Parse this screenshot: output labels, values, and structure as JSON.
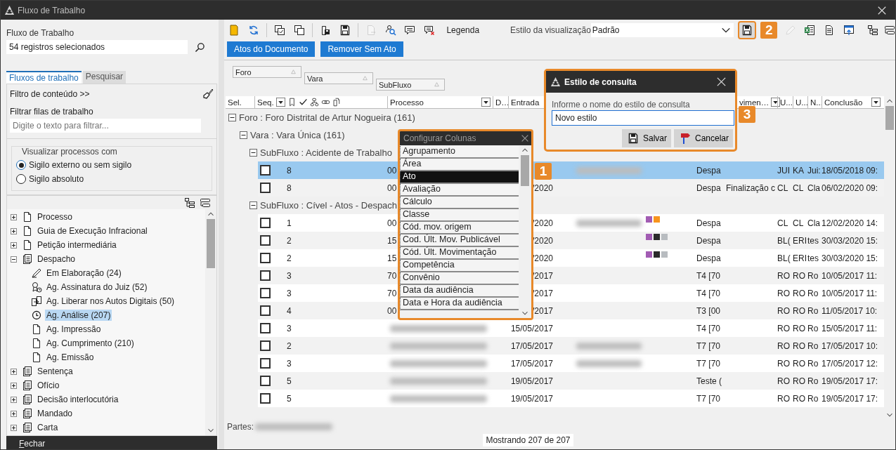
{
  "window": {
    "title": "Fluxo de Trabalho"
  },
  "sidebar": {
    "label": "Fluxo de Trabalho",
    "selection_field": {
      "value": "54 registros selecionados"
    },
    "tabs": [
      {
        "label": "Fluxos de trabalho",
        "selected": true
      },
      {
        "label": "Pesquisar",
        "selected": false
      }
    ],
    "content_filter": "Filtro de conteúdo >>",
    "filter_label": "Filtrar filas de trabalho",
    "filter_field": {
      "placeholder": "Digite o texto para filtrar..."
    },
    "visibility": {
      "legend": "Visualizar processos com",
      "options": [
        {
          "label": "Sigilo externo ou sem sigilo",
          "selected": true
        },
        {
          "label": "Sigilo absoluto",
          "selected": false
        }
      ]
    },
    "tree": [
      {
        "label": "Processo",
        "kind": "page",
        "expanded": false,
        "selected": false
      },
      {
        "label": "Guia de Execução Infracional",
        "kind": "page",
        "expanded": false,
        "selected": false
      },
      {
        "label": "Petição intermediária",
        "kind": "page",
        "expanded": false,
        "selected": false
      },
      {
        "label": "Despacho",
        "kind": "stack",
        "expanded": true,
        "selected": false,
        "children": [
          {
            "label": "Em Elaboração (24)",
            "kind": "pen",
            "selected": false
          },
          {
            "label": "Ag. Assinatura do Juiz (52)",
            "kind": "seal",
            "selected": false
          },
          {
            "label": "Ag. Liberar nos Autos Digitais (50)",
            "kind": "transfer",
            "selected": false
          },
          {
            "label": "Ag. Análise (207)",
            "kind": "clock",
            "selected": true
          },
          {
            "label": "Ag. Impressão",
            "kind": "page",
            "selected": false
          },
          {
            "label": "Ag. Cumprimento (210)",
            "kind": "page",
            "selected": false
          },
          {
            "label": "Ag. Emissão",
            "kind": "page",
            "selected": false
          }
        ]
      },
      {
        "label": "Sentença",
        "kind": "stack",
        "expanded": false,
        "selected": false
      },
      {
        "label": "Ofício",
        "kind": "stack",
        "expanded": false,
        "selected": false
      },
      {
        "label": "Decisão interlocutória",
        "kind": "stack",
        "expanded": false,
        "selected": false
      },
      {
        "label": "Mandado",
        "kind": "stack",
        "expanded": false,
        "selected": false
      },
      {
        "label": "Carta",
        "kind": "stack",
        "expanded": false,
        "selected": false
      }
    ],
    "close_button": "Fechar"
  },
  "main": {
    "toolbar": {
      "tools": [
        {
          "kind": "note",
          "disabled": false
        },
        {
          "kind": "refresh",
          "disabled": false
        },
        {
          "kind": "select",
          "disabled": false
        },
        {
          "kind": "copy",
          "disabled": false
        },
        {
          "kind": "paste",
          "disabled": false
        },
        {
          "kind": "floppy",
          "disabled": false
        },
        {
          "kind": "export",
          "disabled": true
        },
        {
          "kind": "inspect",
          "disabled": false
        },
        {
          "kind": "comment",
          "disabled": false
        },
        {
          "kind": "uncomment",
          "disabled": false
        }
      ],
      "legend": "Legenda",
      "view_style_label": "Estilo da visualização",
      "view_style": {
        "value": "Padrão"
      },
      "style_tools": [
        {
          "kind": "floppy",
          "disabled": false
        },
        {
          "kind": "pencil",
          "disabled": true
        },
        {
          "kind": "excel",
          "disabled": false
        },
        {
          "kind": "document",
          "disabled": false
        },
        {
          "kind": "window",
          "disabled": false
        }
      ]
    },
    "actions": [
      "Atos do Documento",
      "Remover Sem Ato"
    ],
    "grouping": [
      "Foro",
      "Vara",
      "SubFluxo"
    ],
    "table": {
      "columns": [
        "Sel.",
        "Seq.",
        "Processo",
        "D…",
        "Entrada",
        "vimen…",
        "U...",
        "U...",
        "N...",
        "Conclusão"
      ],
      "groups": [
        {
          "label": "Foro : Foro Distrital de Artur Nogueira  (161)",
          "expanded": true,
          "children": [
            {
              "label": "Vara : Vara Única  (161)",
              "expanded": true,
              "children": [
                {
                  "label": "SubFluxo : Acidente de Trabalho",
                  "expanded": true,
                  "rows": [
                    {
                      "seq": "8",
                      "process": "00",
                      "blurred_party": true,
                      "blurred_process": false,
                      "tags": [],
                      "act": "Despa",
                      "u1": "JUI",
                      "u2": "KA",
                      "n": "Jui:",
                      "conclusion": "18/05/2018 09:",
                      "checked": false,
                      "selected": true
                    },
                    {
                      "seq": "8",
                      "process": "00",
                      "entry": "/2020",
                      "blurred_party": false,
                      "blurred_process": false,
                      "tags": [],
                      "act": "Despa",
                      "movement": "Finalização c",
                      "u1": "CL",
                      "u2": "CL",
                      "n": "Cla",
                      "conclusion": "06/02/2020 09:",
                      "checked": false,
                      "selected": false
                    }
                  ]
                },
                {
                  "label": "SubFluxo : Cível - Atos - Despach",
                  "expanded": true,
                  "rows": [
                    {
                      "seq": "1",
                      "process": "00",
                      "entry": "/2020",
                      "blurred_party": true,
                      "blurred_process": false,
                      "tags": [
                        {
                          "color": "#a25cb3"
                        },
                        {
                          "color": "#f7941d"
                        }
                      ],
                      "act": "Despa",
                      "u1": "CL",
                      "u2": "CL",
                      "n": "Cla",
                      "conclusion": "12/02/2020 14:",
                      "checked": false,
                      "selected": false
                    },
                    {
                      "seq": "2",
                      "process": "15",
                      "entry": "/2020",
                      "blurred_party": false,
                      "blurred_process": false,
                      "tags": [
                        {
                          "color": "#a25cb3"
                        },
                        {
                          "color": "#2b2b2b"
                        },
                        {
                          "color": "#b8bcc0"
                        }
                      ],
                      "act": "Despa",
                      "u1": "BL(",
                      "u2": "ERI",
                      "n": "tes",
                      "conclusion": "30/03/2020 15:",
                      "checked": false,
                      "selected": false
                    },
                    {
                      "seq": "2",
                      "process": "15",
                      "entry": "/2020",
                      "blurred_party": false,
                      "blurred_process": false,
                      "tags": [
                        {
                          "color": "#a25cb3"
                        },
                        {
                          "color": "#2b2b2b"
                        },
                        {
                          "color": "#b8bcc0"
                        }
                      ],
                      "act": "Despa",
                      "u1": "BL(",
                      "u2": "ERI",
                      "n": "tes",
                      "conclusion": "30/03/2020 15:",
                      "checked": false,
                      "selected": false
                    },
                    {
                      "seq": "3",
                      "process": "70",
                      "entry": "/2017",
                      "blurred_party": false,
                      "blurred_process": false,
                      "tags": [],
                      "act": "T4 [70",
                      "u1": "RO",
                      "u2": "RO",
                      "n": "Ro",
                      "conclusion": "10/05/2017 11:",
                      "checked": false,
                      "selected": false
                    },
                    {
                      "seq": "3",
                      "process": "70",
                      "entry": "/2017",
                      "blurred_party": false,
                      "blurred_process": false,
                      "tags": [],
                      "act": "T4 [70",
                      "u1": "RO",
                      "u2": "RO",
                      "n": "Ro",
                      "conclusion": "10/05/2017 11:",
                      "checked": false,
                      "selected": false
                    },
                    {
                      "seq": "4",
                      "process": "00",
                      "entry": "/2017",
                      "blurred_party": false,
                      "blurred_process": false,
                      "tags": [],
                      "act": "T3 [00",
                      "u1": "RO",
                      "u2": "RO",
                      "n": "Ro",
                      "conclusion": "11/05/2017 10:",
                      "checked": false,
                      "selected": false
                    },
                    {
                      "seq": "3",
                      "entry": "15/05/2017",
                      "blurred_party": false,
                      "blurred_process": true,
                      "tags": [],
                      "act": "T4 [70",
                      "u1": "RO",
                      "u2": "RO",
                      "n": "Ro",
                      "conclusion": "15/05/2017 11:",
                      "checked": false,
                      "selected": false
                    },
                    {
                      "seq": "2",
                      "entry": "17/05/2017",
                      "blurred_party": true,
                      "blurred_process": true,
                      "tags": [],
                      "act": "T7 [70",
                      "u1": "RO",
                      "u2": "RO",
                      "n": "Ro",
                      "conclusion": "17/05/2017 10:",
                      "checked": false,
                      "selected": false
                    },
                    {
                      "seq": "3",
                      "entry": "17/05/2017",
                      "blurred_party": true,
                      "blurred_process": true,
                      "tags": [],
                      "act": "T7 [70",
                      "u1": "RO",
                      "u2": "RO",
                      "n": "Ro",
                      "conclusion": "17/05/2017 12:",
                      "checked": false,
                      "selected": false
                    },
                    {
                      "seq": "5",
                      "entry": "19/05/2017",
                      "blurred_party": false,
                      "blurred_process": true,
                      "tags": [],
                      "act": "Teste (",
                      "u1": "RO",
                      "u2": "RO",
                      "n": "Ro",
                      "conclusion": "19/05/2017 17:",
                      "checked": false,
                      "selected": false
                    },
                    {
                      "seq": "5",
                      "entry": "19/05/2017",
                      "blurred_party": false,
                      "blurred_process": true,
                      "tags": [],
                      "act": "T7 [70",
                      "u1": "RO",
                      "u2": "RO",
                      "n": "Ro",
                      "conclusion": "19/05/2017 17:",
                      "checked": false,
                      "selected": false
                    }
                  ]
                }
              ]
            }
          ]
        }
      ]
    },
    "parties_label": "Partes:",
    "status": "Mostrando 207 de 207",
    "column_chooser": {
      "title": "Configurar Colunas",
      "items": [
        {
          "label": "Agrupamento",
          "selected": false
        },
        {
          "label": "Área",
          "selected": false
        },
        {
          "label": "Ato",
          "selected": true
        },
        {
          "label": "Avaliação",
          "selected": false
        },
        {
          "label": "Cálculo",
          "selected": false
        },
        {
          "label": "Classe",
          "selected": false
        },
        {
          "label": "Cód. mov. origem",
          "selected": false
        },
        {
          "label": "Cod. Últ. Mov. Publicável",
          "selected": false
        },
        {
          "label": "Cód. Últ. Movimentação",
          "selected": false
        },
        {
          "label": "Competência",
          "selected": false
        },
        {
          "label": "Convênio",
          "selected": false
        },
        {
          "label": "Data da audiência",
          "selected": false
        },
        {
          "label": "Data e Hora da audiência",
          "selected": false
        }
      ]
    },
    "style_dialog": {
      "title": "Estilo de consulta",
      "prompt": "Informe o nome do estilo de consulta",
      "name_field": {
        "value": "Novo estilo"
      },
      "buttons": [
        {
          "label": "Salvar",
          "kind": "save"
        },
        {
          "label": "Cancelar",
          "kind": "cancel"
        }
      ]
    },
    "callouts": [
      "1",
      "2",
      "3"
    ]
  }
}
